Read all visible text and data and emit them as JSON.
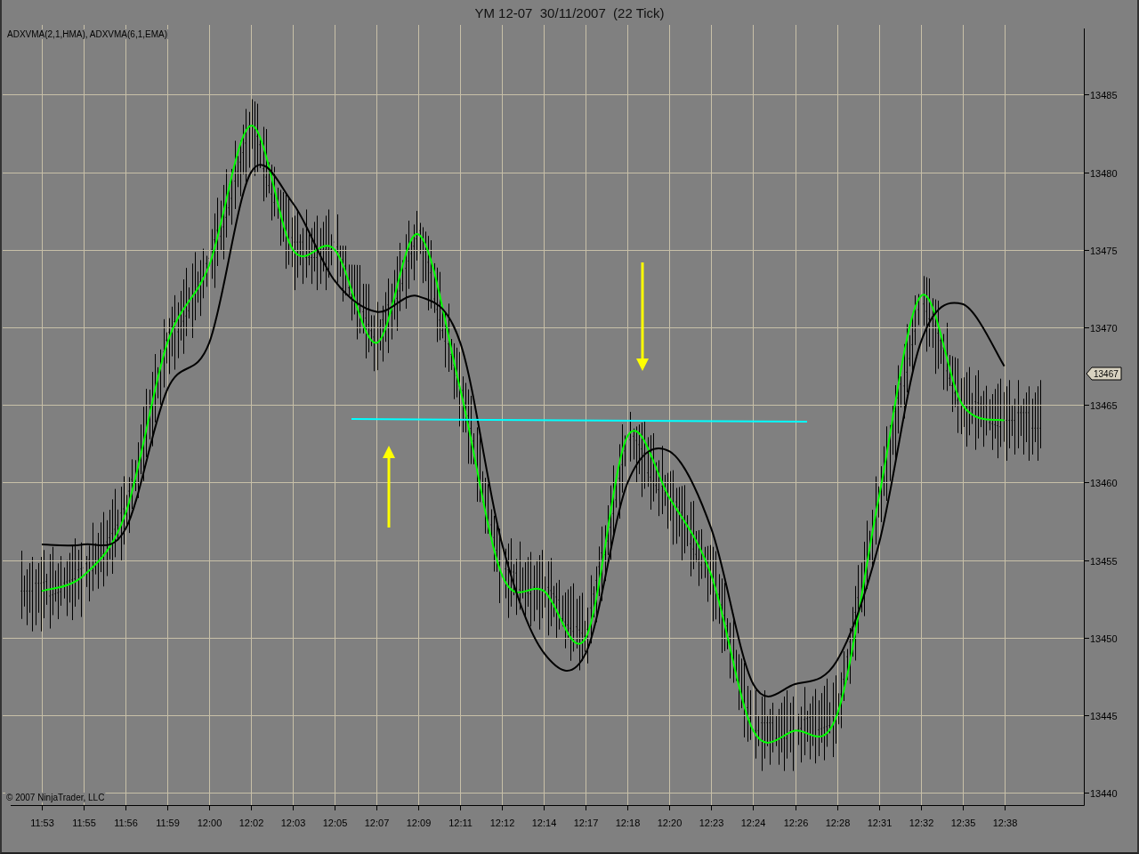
{
  "window": {
    "title": "YM 12-07  30/11/2007  (22 Tick)"
  },
  "chart": {
    "copyright": "© 2007 NinjaTrader, LLC",
    "last_price_tag": "13467",
    "legend_separator": ",",
    "chart_data": {
      "type": "line",
      "grid": true,
      "categories": [
        "11:53",
        "11:55",
        "11:56",
        "11:59",
        "12:00",
        "12:02",
        "12:03",
        "12:05",
        "12:07",
        "12:09",
        "12:11",
        "12:12",
        "12:14",
        "12:17",
        "12:18",
        "12:20",
        "12:23",
        "12:24",
        "12:26",
        "12:28",
        "12:31",
        "12:32",
        "12:35",
        "12:38"
      ],
      "series": [
        {
          "name": "ADXVMA(2,1,HMA)",
          "color": "#00ff00",
          "values": [
            13453,
            13454,
            13458,
            13469,
            13474,
            13483,
            13475,
            13475,
            13469,
            13476,
            13466,
            13454,
            13453,
            13450,
            13463,
            13459,
            13454,
            13444,
            13444,
            13445,
            13459,
            13472,
            13465,
            13464
          ]
        },
        {
          "name": "ADXVMA(6,1,EMA)",
          "color": "#000000",
          "values": [
            13456,
            13456,
            13457,
            13466,
            13469,
            13480,
            13478,
            13473,
            13471,
            13472,
            13469,
            13456,
            13449,
            13449,
            13460,
            13462,
            13457,
            13447,
            13447,
            13448.5,
            13456,
            13469,
            13471.5,
            13467.5
          ]
        }
      ],
      "ylim": [
        13439.2,
        13489.5
      ],
      "yticks": [
        13440,
        13445,
        13450,
        13455,
        13460,
        13465,
        13470,
        13475,
        13480,
        13485
      ]
    }
  }
}
